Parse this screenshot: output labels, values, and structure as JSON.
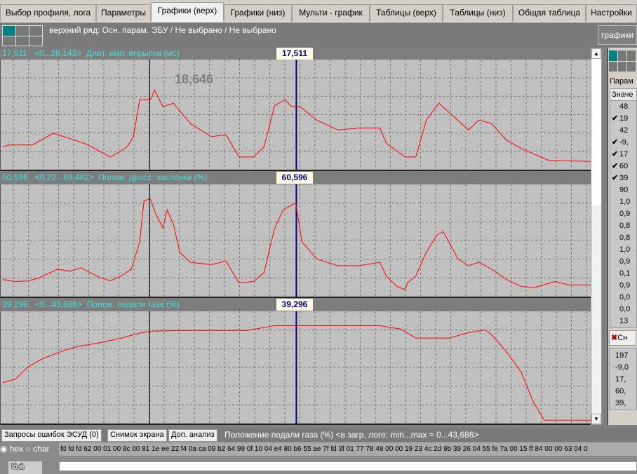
{
  "tabs": [
    "Выбор профиля, лога",
    "Параметры",
    "Графики (верх)",
    "Графики (низ)",
    "Мульти - график",
    "Таблицы (верх)",
    "Таблицы (низ)",
    "Общая таблица",
    "Настройки"
  ],
  "active_tab": 2,
  "toolbar": {
    "description": "верхний ряд: Осн. парам. ЭБУ / Не выбрано / Не выбрано",
    "right_button": "графики"
  },
  "cursor_hint": "18,646",
  "panels": [
    {
      "value": "17,511",
      "range": "<0...28,143>",
      "name": "Длит. имп. впрыска (мс)",
      "cursor_value": "17,511"
    },
    {
      "value": "60,596",
      "range": "<0,22...69,482>",
      "name": "Полож. дросс. заслонки (%)",
      "cursor_value": "60,596"
    },
    {
      "value": "39,296",
      "range": "<0...43,686>",
      "name": "Полож. педали газа (%)",
      "cursor_value": "39,296"
    }
  ],
  "chart_data": [
    {
      "type": "line",
      "ylim": [
        0,
        28.143
      ],
      "color": "#ff0000",
      "grid": true,
      "points": [
        [
          1,
          5.7
        ],
        [
          4,
          6.2
        ],
        [
          15,
          6.2
        ],
        [
          25,
          9.3
        ],
        [
          30,
          8.4
        ],
        [
          35,
          7.5
        ],
        [
          40,
          6.6
        ],
        [
          52,
          3.0
        ],
        [
          55,
          3.9
        ],
        [
          60,
          5.7
        ],
        [
          63,
          8.4
        ],
        [
          66,
          18.2
        ],
        [
          71,
          18.2
        ],
        [
          73,
          20.8
        ],
        [
          77,
          16.4
        ],
        [
          82,
          17.3
        ],
        [
          90,
          11.9
        ],
        [
          100,
          8.4
        ],
        [
          107,
          8.9
        ],
        [
          113,
          3.0
        ],
        [
          120,
          3.0
        ],
        [
          125,
          5.7
        ],
        [
          130,
          16.7
        ],
        [
          135,
          18.2
        ],
        [
          138,
          16.4
        ],
        [
          142,
          16.4
        ],
        [
          150,
          12.8
        ],
        [
          160,
          10.2
        ],
        [
          170,
          10.7
        ],
        [
          180,
          10.7
        ],
        [
          183,
          6.6
        ],
        [
          192,
          3.0
        ],
        [
          197,
          3.0
        ],
        [
          202,
          12.8
        ],
        [
          208,
          17.3
        ],
        [
          222,
          10.2
        ],
        [
          227,
          12.8
        ],
        [
          233,
          11.9
        ],
        [
          240,
          7.5
        ],
        [
          247,
          5.3
        ],
        [
          260,
          2.1
        ],
        [
          280,
          1.8
        ]
      ]
    },
    {
      "type": "line",
      "ylim": [
        0.22,
        69.482
      ],
      "color": "#ff0000",
      "grid": true,
      "points": [
        [
          1,
          10.3
        ],
        [
          7,
          9.0
        ],
        [
          13,
          9.4
        ],
        [
          18,
          11.2
        ],
        [
          27,
          16.9
        ],
        [
          33,
          15.6
        ],
        [
          38,
          17.8
        ],
        [
          47,
          11.6
        ],
        [
          52,
          9.4
        ],
        [
          57,
          12.5
        ],
        [
          62,
          16.9
        ],
        [
          66,
          34.4
        ],
        [
          68,
          60.7
        ],
        [
          71,
          62.0
        ],
        [
          73,
          54.1
        ],
        [
          77,
          43.2
        ],
        [
          79,
          55.0
        ],
        [
          82,
          45.4
        ],
        [
          85,
          27.8
        ],
        [
          90,
          21.3
        ],
        [
          100,
          19.9
        ],
        [
          107,
          22.1
        ],
        [
          113,
          8.1
        ],
        [
          120,
          9.0
        ],
        [
          125,
          14.7
        ],
        [
          128,
          32.2
        ],
        [
          130,
          43.2
        ],
        [
          134,
          55.0
        ],
        [
          140,
          59.4
        ],
        [
          143,
          34.4
        ],
        [
          150,
          23.5
        ],
        [
          160,
          19.1
        ],
        [
          170,
          19.1
        ],
        [
          180,
          21.3
        ],
        [
          183,
          12.5
        ],
        [
          188,
          5.9
        ],
        [
          192,
          3.7
        ],
        [
          193,
          8.1
        ],
        [
          197,
          12.5
        ],
        [
          202,
          27.8
        ],
        [
          207,
          38.8
        ],
        [
          210,
          41.0
        ],
        [
          217,
          23.5
        ],
        [
          222,
          19.1
        ],
        [
          227,
          21.3
        ],
        [
          233,
          16.9
        ],
        [
          240,
          10.3
        ],
        [
          247,
          5.9
        ],
        [
          253,
          5.0
        ],
        [
          263,
          9.0
        ],
        [
          270,
          6.8
        ],
        [
          280,
          6.8
        ]
      ]
    },
    {
      "type": "line",
      "ylim": [
        0,
        43.686
      ],
      "color": "#ff0000",
      "grid": true,
      "points": [
        [
          1,
          16.0
        ],
        [
          7,
          17.4
        ],
        [
          13,
          22.4
        ],
        [
          20,
          25.7
        ],
        [
          30,
          29.0
        ],
        [
          37,
          30.7
        ],
        [
          47,
          32.1
        ],
        [
          55,
          33.5
        ],
        [
          67,
          36.2
        ],
        [
          72,
          36.8
        ],
        [
          87,
          37.1
        ],
        [
          117,
          37.1
        ],
        [
          130,
          39.0
        ],
        [
          137,
          39.0
        ],
        [
          180,
          39.0
        ],
        [
          190,
          37.6
        ],
        [
          197,
          34.0
        ],
        [
          213,
          34.0
        ],
        [
          222,
          36.2
        ],
        [
          230,
          37.3
        ],
        [
          233,
          35.4
        ],
        [
          240,
          28.5
        ],
        [
          247,
          20.2
        ],
        [
          253,
          7.7
        ],
        [
          258,
          0.8
        ],
        [
          280,
          0.8
        ]
      ]
    }
  ],
  "cursors": {
    "black_t": 70.7,
    "blue_t": 140.3,
    "t_range": [
      0,
      280
    ]
  },
  "right_panel": {
    "tab": "Парам",
    "column": "Значе",
    "values": [
      "48",
      "19",
      "42",
      "-9,",
      "17",
      "60",
      "39",
      "90",
      "1,0",
      "0,9",
      "0,8",
      "0,8",
      "1,0",
      "0,9",
      "0,1",
      "0,9",
      "0,0",
      "0,0",
      "13"
    ],
    "checked": [
      false,
      true,
      false,
      true,
      true,
      true,
      true,
      false,
      false,
      false,
      false,
      false,
      false,
      false,
      false,
      false,
      false,
      false,
      false
    ],
    "clear_button": "Сн",
    "summary": [
      "197",
      "-9,0",
      "17,",
      "60,",
      "39,"
    ]
  },
  "bottom": {
    "tabs": [
      "Запросы ошибок ЭСУД (0)",
      "Снимок экрана",
      "Доп. анализ"
    ],
    "status": "Положение педали газа (%) <в загр. логе: min...max = 0...43,686>",
    "radio_hex": "hex",
    "radio_char": "char",
    "hex": "fd fd fd 62 00 01 00 8c 00 81 1e ee 22 f4 0a ca 09 b2 64 99 0f 10 04 e4 80 b6 55 ae 7f fd 3f 01 77 78 48 00 00 19 23 4c 2d 9b 39 26 04 55 fe 7a 00 15 ff 84 00 00 63 04 0",
    "input": ""
  }
}
